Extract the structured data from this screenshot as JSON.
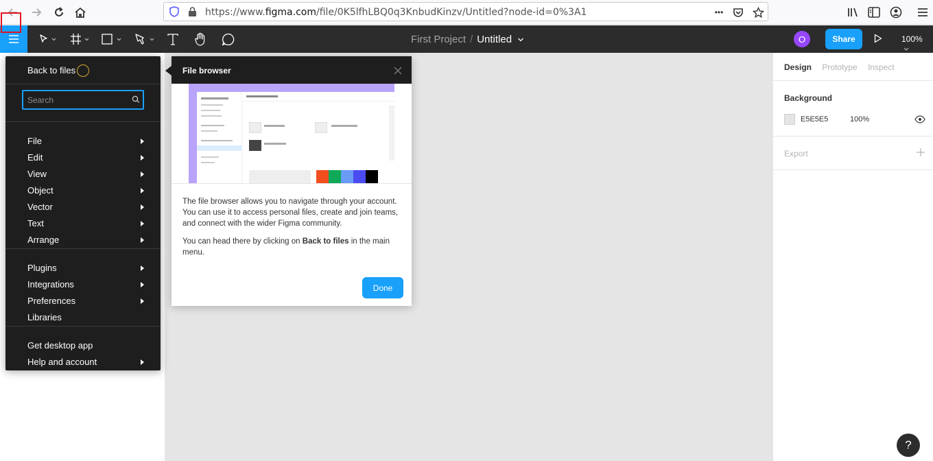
{
  "browser": {
    "url_prefix": "https://www.",
    "url_domain": "figma.com",
    "url_path": "/file/0K5lfhLBQ0q3KnbudKinzv/Untitled?node-id=0%3A1",
    "more_glyph": "•••"
  },
  "toolbar": {
    "project": "First Project",
    "separator": "/",
    "file_name": "Untitled",
    "avatar_initial": "O",
    "share_label": "Share",
    "zoom": "100%"
  },
  "menu": {
    "back_to_files": "Back to files",
    "search_placeholder": "Search",
    "groups": [
      [
        {
          "label": "File",
          "submenu": true
        },
        {
          "label": "Edit",
          "submenu": true
        },
        {
          "label": "View",
          "submenu": true
        },
        {
          "label": "Object",
          "submenu": true
        },
        {
          "label": "Vector",
          "submenu": true
        },
        {
          "label": "Text",
          "submenu": true
        },
        {
          "label": "Arrange",
          "submenu": true
        }
      ],
      [
        {
          "label": "Plugins",
          "submenu": true
        },
        {
          "label": "Integrations",
          "submenu": true
        },
        {
          "label": "Preferences",
          "submenu": true
        },
        {
          "label": "Libraries",
          "submenu": false
        }
      ],
      [
        {
          "label": "Get desktop app",
          "submenu": false
        },
        {
          "label": "Help and account",
          "submenu": true
        }
      ]
    ]
  },
  "popover": {
    "title": "File browser",
    "paragraph1": "The file browser allows you to navigate through your account. You can use it to access personal files, create and join teams, and connect with the wider Figma community.",
    "paragraph2_before": "You can head there by clicking on ",
    "paragraph2_bold": "Back to files",
    "paragraph2_after": " in the main menu.",
    "done_label": "Done"
  },
  "right_panel": {
    "tabs": [
      "Design",
      "Prototype",
      "Inspect"
    ],
    "active_tab": "Design",
    "background_title": "Background",
    "background_hex": "E5E5E5",
    "background_opacity": "100%",
    "export_label": "Export"
  },
  "help_label": "?",
  "colors": {
    "accent": "#18a0fb",
    "toolbar": "#2c2c2c",
    "menu_bg": "#1e1e1e",
    "canvas": "#e5e5e5",
    "avatar": "#9747ff",
    "highlight": "#e0141e"
  }
}
